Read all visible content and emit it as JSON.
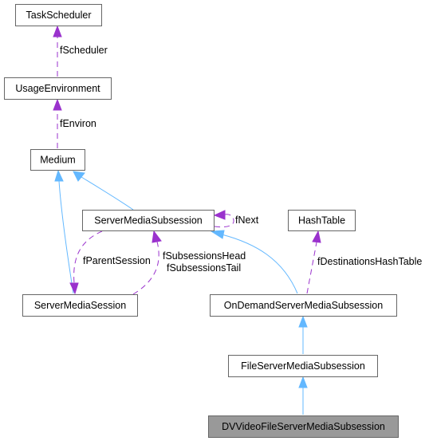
{
  "diagram": {
    "type": "class-collaboration-graph",
    "nodes": [
      {
        "id": "TaskScheduler",
        "label": "TaskScheduler",
        "current": false
      },
      {
        "id": "UsageEnvironment",
        "label": "UsageEnvironment",
        "current": false
      },
      {
        "id": "Medium",
        "label": "Medium",
        "current": false
      },
      {
        "id": "ServerMediaSubsession",
        "label": "ServerMediaSubsession",
        "current": false
      },
      {
        "id": "HashTable",
        "label": "HashTable",
        "current": false
      },
      {
        "id": "ServerMediaSession",
        "label": "ServerMediaSession",
        "current": false
      },
      {
        "id": "OnDemandServerMediaSubsession",
        "label": "OnDemandServerMediaSubsession",
        "current": false
      },
      {
        "id": "FileServerMediaSubsession",
        "label": "FileServerMediaSubsession",
        "current": false
      },
      {
        "id": "DVVideoFileServerMediaSubsession",
        "label": "DVVideoFileServerMediaSubsession",
        "current": true
      }
    ],
    "edges": [
      {
        "from": "UsageEnvironment",
        "to": "TaskScheduler",
        "kind": "usage",
        "label": "fScheduler"
      },
      {
        "from": "Medium",
        "to": "UsageEnvironment",
        "kind": "usage",
        "label": "fEnviron"
      },
      {
        "from": "ServerMediaSubsession",
        "to": "Medium",
        "kind": "inheritance",
        "label": ""
      },
      {
        "from": "ServerMediaSession",
        "to": "Medium",
        "kind": "inheritance",
        "label": ""
      },
      {
        "from": "ServerMediaSubsession",
        "to": "ServerMediaSubsession",
        "kind": "usage",
        "label": "fNext"
      },
      {
        "from": "ServerMediaSubsession",
        "to": "ServerMediaSession",
        "kind": "usage",
        "label": "fParentSession"
      },
      {
        "from": "ServerMediaSession",
        "to": "ServerMediaSubsession",
        "kind": "usage",
        "label": "fSubsessionsHead\nfSubsessionsTail",
        "label_lines": [
          "fSubsessionsHead",
          "fSubsessionsTail"
        ]
      },
      {
        "from": "OnDemandServerMediaSubsession",
        "to": "ServerMediaSubsession",
        "kind": "inheritance",
        "label": ""
      },
      {
        "from": "OnDemandServerMediaSubsession",
        "to": "HashTable",
        "kind": "usage",
        "label": "fDestinationsHashTable"
      },
      {
        "from": "FileServerMediaSubsession",
        "to": "OnDemandServerMediaSubsession",
        "kind": "inheritance",
        "label": ""
      },
      {
        "from": "DVVideoFileServerMediaSubsession",
        "to": "FileServerMediaSubsession",
        "kind": "inheritance",
        "label": ""
      }
    ],
    "colors": {
      "inheritance": "#63b8ff",
      "usage": "#9a32cd",
      "node_border": "#666666",
      "current_fill": "#999999"
    }
  }
}
